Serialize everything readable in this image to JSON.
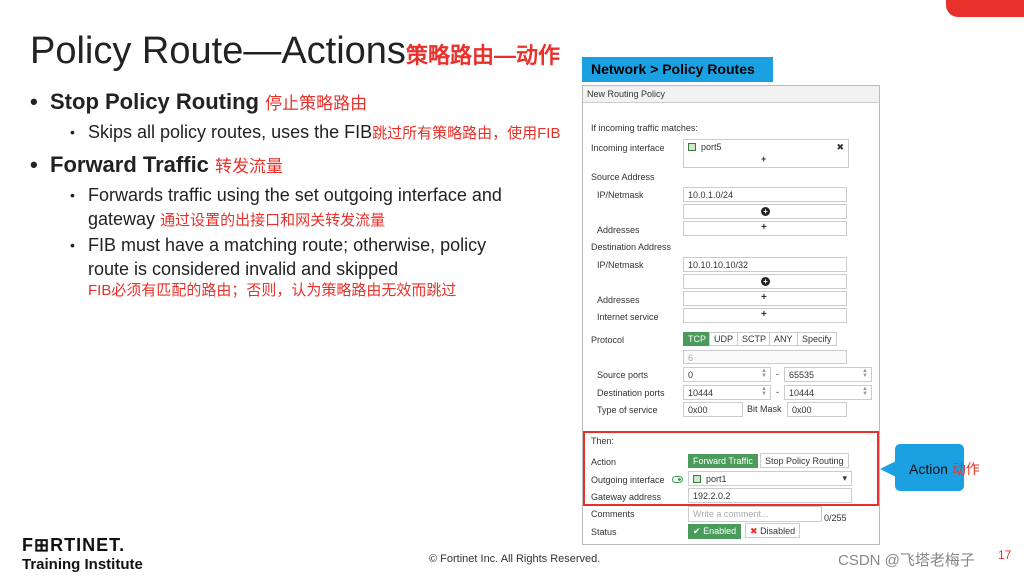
{
  "slide": {
    "title": "Policy Route—Actions",
    "title_cn": "策略路由—动作",
    "bullets": {
      "stop": {
        "title": "Stop Policy Routing",
        "title_cn": "停止策略路由",
        "sub1": "Skips all policy routes, uses the FIB",
        "sub1_cn": "跳过所有策略路由，使用FIB"
      },
      "forward": {
        "title": "Forward Traffic",
        "title_cn": "转发流量",
        "sub1_line1": "Forwards traffic using the set outgoing interface and",
        "sub1_line2": "gateway",
        "sub1_cn": "通过设置的出接口和网关转发流量",
        "sub2_line1": "FIB must have a matching route; otherwise, policy",
        "sub2_line2": "route is considered invalid and skipped",
        "sub2_cn": "FIB必须有匹配的路由；否则，认为策略路由无效而跳过"
      }
    },
    "bullet_glyph": "•"
  },
  "breadcrumb": "Network > Policy Routes",
  "form": {
    "header": "New Routing Policy",
    "if_incoming": "If incoming traffic matches:",
    "incoming_interface_label": "Incoming interface",
    "incoming_interface_value": "port5",
    "remove_glyph": "✖",
    "add_glyph": "+",
    "add_circle_glyph": "+",
    "source_address_label": "Source Address",
    "ip_netmask_label": "IP/Netmask",
    "source_ip_value": "10.0.1.0/24",
    "addresses_label": "Addresses",
    "destination_address_label": "Destination Address",
    "dest_ip_value": "10.10.10.10/32",
    "internet_service_label": "Internet service",
    "protocol_label": "Protocol",
    "protocol_options": [
      "TCP",
      "UDP",
      "SCTP",
      "ANY",
      "Specify"
    ],
    "protocol_number": "6",
    "source_ports_label": "Source ports",
    "source_port_from": "0",
    "source_port_to": "65535",
    "dash": "-",
    "destination_ports_label": "Destination ports",
    "dest_port_from": "10444",
    "dest_port_to": "10444",
    "tos_label": "Type of service",
    "tos_value": "0x00",
    "bitmask_label": "Bit Mask",
    "bitmask_value": "0x00",
    "then_label": "Then:",
    "action_label": "Action",
    "action_forward": "Forward Traffic",
    "action_stop": "Stop Policy Routing",
    "outgoing_interface_label": "Outgoing interface",
    "outgoing_interface_value": "port1",
    "dropdown_glyph": "▾",
    "gateway_label": "Gateway address",
    "gateway_value": "192.2.0.2",
    "comments_label": "Comments",
    "comments_placeholder": "Write a comment...",
    "comments_count": "0/255",
    "status_label": "Status",
    "status_enabled": "Enabled",
    "status_disabled": "Disabled",
    "enabled_glyph": "✔",
    "disabled_glyph": "✖"
  },
  "callout": {
    "text": "Action",
    "text_cn": "动作"
  },
  "footer": {
    "logo": "F⊞RTINET.",
    "logo_sub": "Training Institute",
    "copyright": "© Fortinet Inc. All Rights Reserved.",
    "page": "17",
    "watermark": "CSDN @飞塔老梅子"
  },
  "colors": {
    "accent": "#e8312a",
    "blue": "#1ba1e2",
    "green": "#4a9a5c"
  }
}
